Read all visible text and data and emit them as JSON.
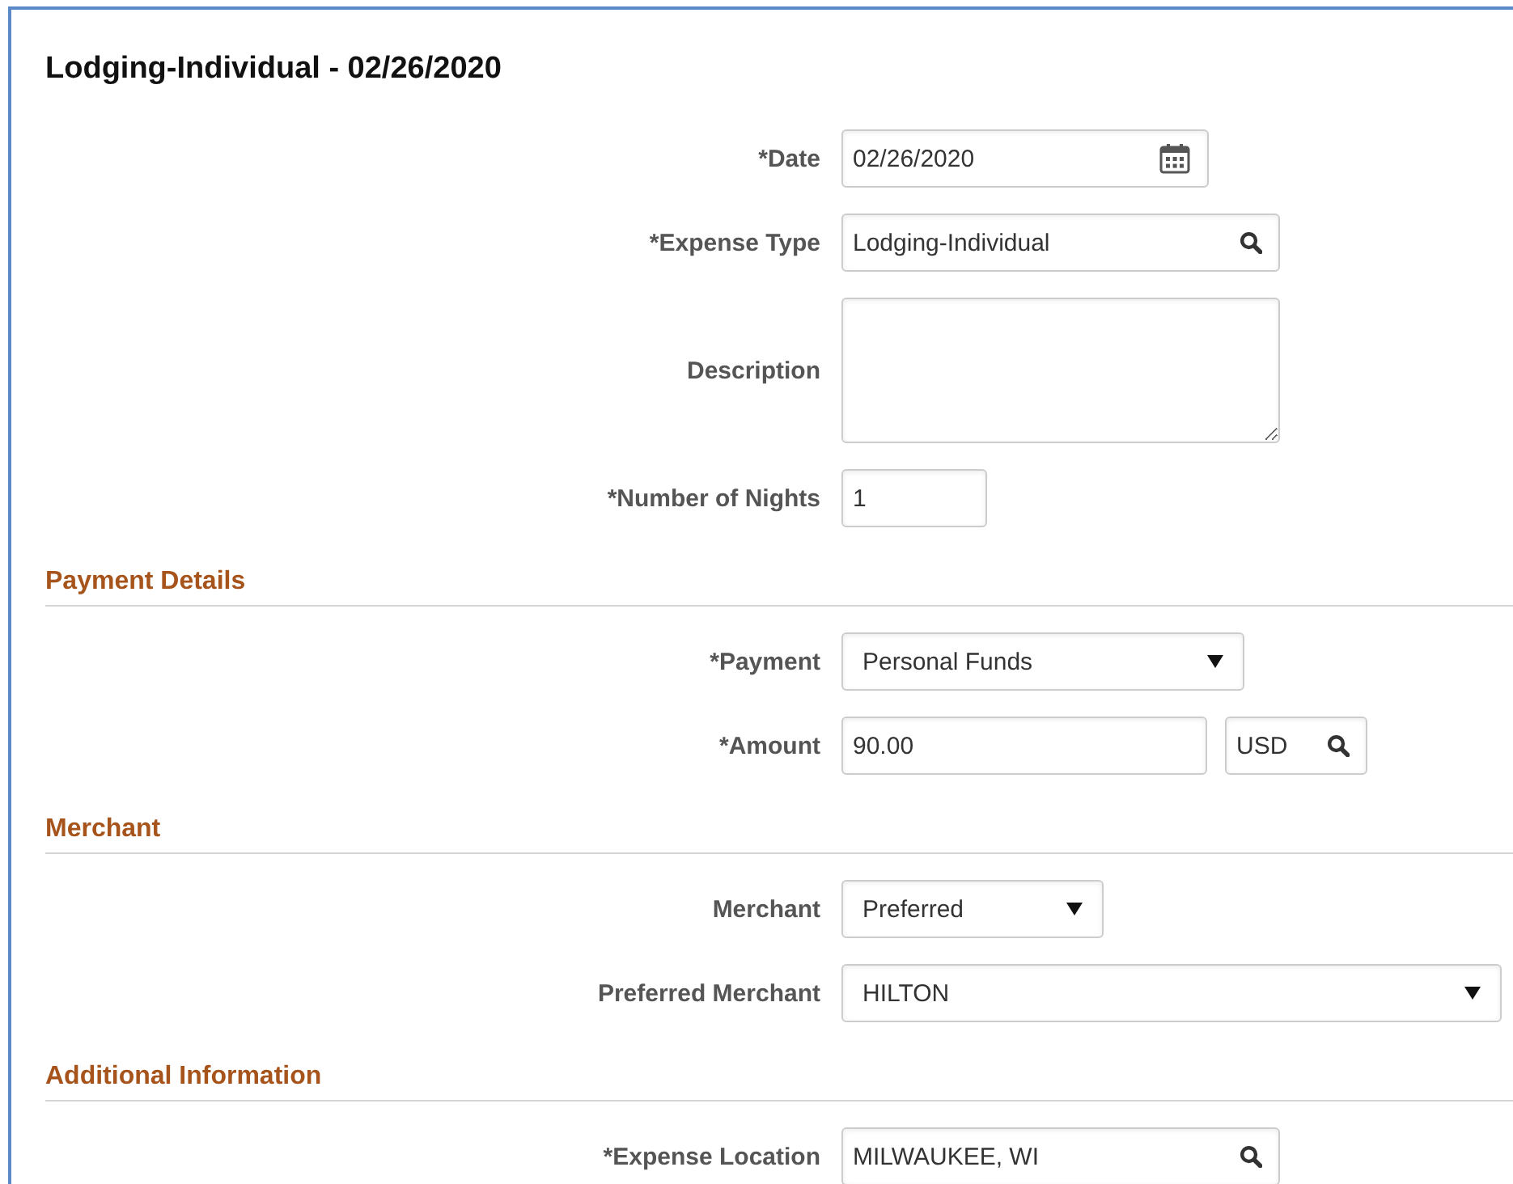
{
  "title": "Lodging-Individual - 02/26/2020",
  "sections": [
    {
      "fields": [
        {
          "kind": "date",
          "label": "*Date",
          "value": "02/26/2020"
        },
        {
          "kind": "lookup",
          "label": "*Expense Type",
          "value": "Lodging-Individual"
        },
        {
          "kind": "textarea",
          "label": "Description"
        },
        {
          "kind": "text",
          "label": "*Number of Nights",
          "value": "1"
        }
      ]
    },
    {
      "heading": "Payment Details",
      "fields": [
        {
          "kind": "select",
          "label": "*Payment",
          "value": "Personal Funds"
        },
        {
          "kind": "amount",
          "label": "*Amount",
          "value": "90.00",
          "currency": "USD"
        }
      ]
    },
    {
      "heading": "Merchant",
      "fields": [
        {
          "kind": "select",
          "label": "Merchant",
          "value": "Preferred"
        },
        {
          "kind": "select",
          "label": "Preferred Merchant",
          "value": "HILTON"
        }
      ]
    },
    {
      "heading": "Additional Information",
      "fields": [
        {
          "kind": "lookup",
          "label": "*Expense Location",
          "value": "MILWAUKEE, WI"
        }
      ]
    }
  ]
}
